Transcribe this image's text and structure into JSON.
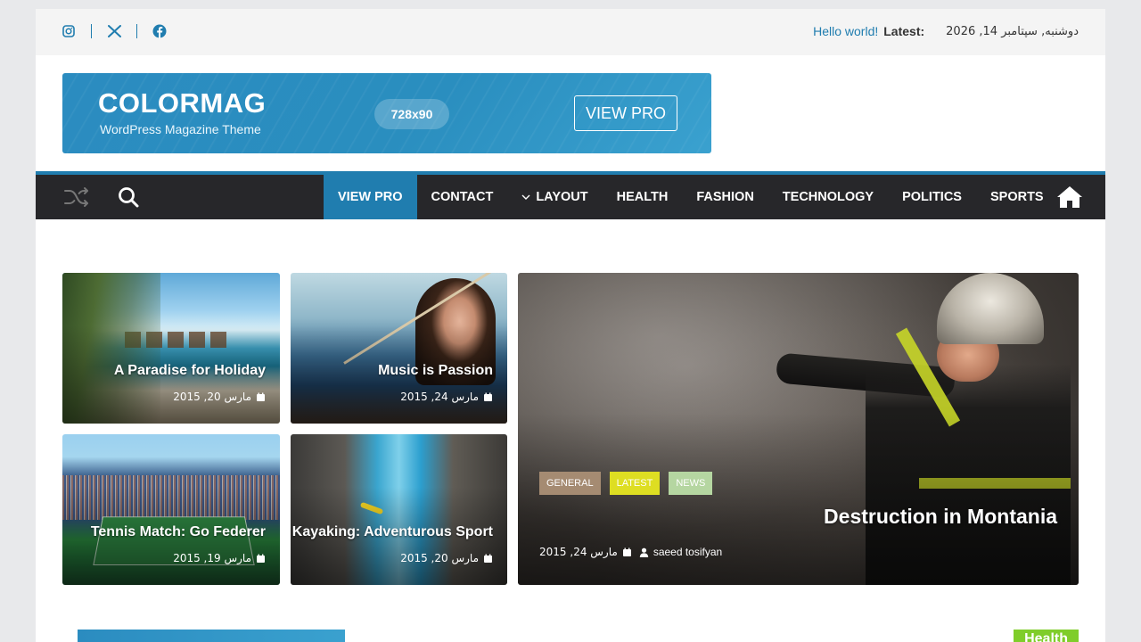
{
  "topbar": {
    "date": "دوشنبه, سپتامبر 14, 2026",
    "latest_label": "Latest:",
    "latest_link": "Hello world!",
    "socials": [
      "facebook-icon",
      "x-icon",
      "instagram-icon"
    ]
  },
  "banner": {
    "logo": "COLORMAG",
    "tagline": "WordPress Magazine Theme",
    "size": "728x90",
    "cta": "VIEW PRO"
  },
  "nav": {
    "items": [
      {
        "label": "VIEW PRO",
        "active": true
      },
      {
        "label": "CONTACT"
      },
      {
        "label": "LAYOUT",
        "dropdown": true
      },
      {
        "label": "HEALTH"
      },
      {
        "label": "FASHION"
      },
      {
        "label": "TECHNOLOGY"
      },
      {
        "label": "POLITICS"
      },
      {
        "label": "SPORTS"
      }
    ]
  },
  "tiles": [
    {
      "title": "A Paradise for Holiday",
      "date": "مارس 20, 2015"
    },
    {
      "title": "Music is Passion",
      "date": "مارس 24, 2015"
    },
    {
      "title": "Tennis Match: Go Federer",
      "date": "مارس 19, 2015"
    },
    {
      "title": "Kayaking: Adventurous Sport",
      "date": "مارس 20, 2015"
    }
  ],
  "featured": {
    "categories": [
      {
        "label": "GENERAL",
        "color": "#a58b72"
      },
      {
        "label": "LATEST",
        "color": "#dede22"
      },
      {
        "label": "NEWS",
        "color": "#b5d6a1"
      }
    ],
    "title": "Destruction in Montania",
    "date": "مارس 24, 2015",
    "author": "saeed tosifyan"
  },
  "bottom": {
    "health_badge": "Health"
  },
  "colors": {
    "accent": "#207daf",
    "nav_bg": "#27272a",
    "health": "#7fcd2a"
  }
}
